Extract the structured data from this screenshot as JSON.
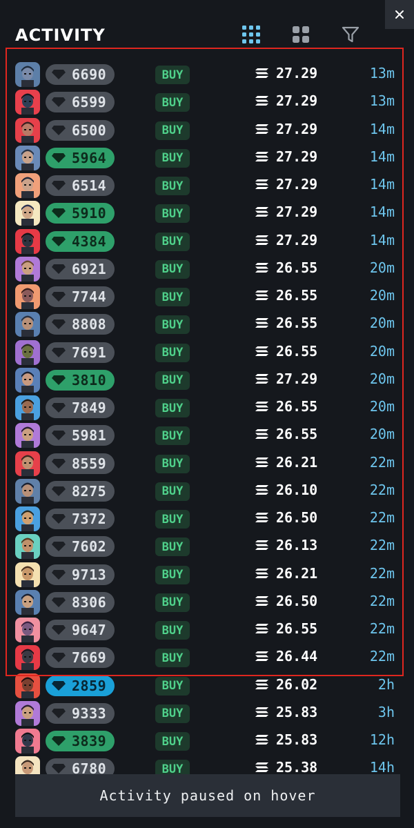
{
  "header": {
    "title": "ACTIVITY"
  },
  "icons": {
    "close": "close-icon",
    "grid_small": "grid-small-icon",
    "grid_large": "grid-large-icon",
    "filter": "filter-icon",
    "diamond": "diamond-icon",
    "currency": "solana-icon"
  },
  "colors": {
    "accent_blue": "#6ec6ee",
    "buy_green": "#4fd08a",
    "pill_gray": "#4b5058",
    "pill_green": "#2ea06a",
    "pill_blue": "#1aa0d8",
    "highlight_red": "#e0261f"
  },
  "activity": [
    {
      "rank": "6690",
      "rarity": "gray",
      "action": "BUY",
      "price": "27.29",
      "time": "13m",
      "avatar_bg": "#5d7fa8",
      "face": "#7a8aa8",
      "hair": "#1e2a3a"
    },
    {
      "rank": "6599",
      "rarity": "gray",
      "action": "BUY",
      "price": "27.29",
      "time": "13m",
      "avatar_bg": "#e8404c",
      "face": "#2e3f56",
      "hair": "#101820"
    },
    {
      "rank": "6500",
      "rarity": "gray",
      "action": "BUY",
      "price": "27.29",
      "time": "14m",
      "avatar_bg": "#e6404a",
      "face": "#b97a66",
      "hair": "#3a2020"
    },
    {
      "rank": "5964",
      "rarity": "green",
      "action": "BUY",
      "price": "27.29",
      "time": "14m",
      "avatar_bg": "#6a8ab8",
      "face": "#c8a28a",
      "hair": "#2a3444"
    },
    {
      "rank": "6514",
      "rarity": "gray",
      "action": "BUY",
      "price": "27.29",
      "time": "14m",
      "avatar_bg": "#f0a07a",
      "face": "#caa28a",
      "hair": "#20283a"
    },
    {
      "rank": "5910",
      "rarity": "green",
      "action": "BUY",
      "price": "27.29",
      "time": "14m",
      "avatar_bg": "#f4e8c0",
      "face": "#d0a888",
      "hair": "#2a3050"
    },
    {
      "rank": "4384",
      "rarity": "green",
      "action": "BUY",
      "price": "27.29",
      "time": "14m",
      "avatar_bg": "#e63a46",
      "face": "#2e3440",
      "hair": "#101418"
    },
    {
      "rank": "6921",
      "rarity": "gray",
      "action": "BUY",
      "price": "26.55",
      "time": "20m",
      "avatar_bg": "#b07ad8",
      "face": "#caa080",
      "hair": "#6a4a30"
    },
    {
      "rank": "7744",
      "rarity": "gray",
      "action": "BUY",
      "price": "26.55",
      "time": "20m",
      "avatar_bg": "#f09a70",
      "face": "#8a5a5a",
      "hair": "#3a2020"
    },
    {
      "rank": "8808",
      "rarity": "gray",
      "action": "BUY",
      "price": "26.55",
      "time": "20m",
      "avatar_bg": "#5a80b0",
      "face": "#b89078",
      "hair": "#2a3040"
    },
    {
      "rank": "7691",
      "rarity": "gray",
      "action": "BUY",
      "price": "26.55",
      "time": "20m",
      "avatar_bg": "#a070d0",
      "face": "#6a7040",
      "hair": "#2a2a20"
    },
    {
      "rank": "3810",
      "rarity": "green",
      "action": "BUY",
      "price": "27.29",
      "time": "20m",
      "avatar_bg": "#5a80b8",
      "face": "#c89a80",
      "hair": "#1a2030"
    },
    {
      "rank": "7849",
      "rarity": "gray",
      "action": "BUY",
      "price": "26.55",
      "time": "20m",
      "avatar_bg": "#4aa0e0",
      "face": "#9a6a50",
      "hair": "#2a1a10"
    },
    {
      "rank": "5981",
      "rarity": "gray",
      "action": "BUY",
      "price": "26.55",
      "time": "20m",
      "avatar_bg": "#b07ad8",
      "face": "#caa080",
      "hair": "#2a2030"
    },
    {
      "rank": "8559",
      "rarity": "gray",
      "action": "BUY",
      "price": "26.21",
      "time": "22m",
      "avatar_bg": "#e6404a",
      "face": "#c09070",
      "hair": "#3a2a20"
    },
    {
      "rank": "8275",
      "rarity": "gray",
      "action": "BUY",
      "price": "26.10",
      "time": "22m",
      "avatar_bg": "#6080a8",
      "face": "#b89078",
      "hair": "#1a2030"
    },
    {
      "rank": "7372",
      "rarity": "gray",
      "action": "BUY",
      "price": "26.50",
      "time": "22m",
      "avatar_bg": "#4aa0e0",
      "face": "#d0a070",
      "hair": "#2a2a20"
    },
    {
      "rank": "7602",
      "rarity": "gray",
      "action": "BUY",
      "price": "26.13",
      "time": "22m",
      "avatar_bg": "#6ad0c0",
      "face": "#c0906a",
      "hair": "#5a3a20"
    },
    {
      "rank": "9713",
      "rarity": "gray",
      "action": "BUY",
      "price": "26.21",
      "time": "22m",
      "avatar_bg": "#f4e0b0",
      "face": "#c8986a",
      "hair": "#4a3020"
    },
    {
      "rank": "8306",
      "rarity": "gray",
      "action": "BUY",
      "price": "26.50",
      "time": "22m",
      "avatar_bg": "#5a80b0",
      "face": "#c8a080",
      "hair": "#1a2030"
    },
    {
      "rank": "9647",
      "rarity": "gray",
      "action": "BUY",
      "price": "26.55",
      "time": "22m",
      "avatar_bg": "#f090a0",
      "face": "#7a5a80",
      "hair": "#3a2040"
    },
    {
      "rank": "7669",
      "rarity": "gray",
      "action": "BUY",
      "price": "26.44",
      "time": "22m",
      "avatar_bg": "#e63a46",
      "face": "#3a3a44",
      "hair": "#181820"
    },
    {
      "rank": "2859",
      "rarity": "blue",
      "action": "BUY",
      "price": "26.02",
      "time": "2h",
      "avatar_bg": "#e65040",
      "face": "#7a4030",
      "hair": "#201010"
    },
    {
      "rank": "9333",
      "rarity": "gray",
      "action": "BUY",
      "price": "25.83",
      "time": "3h",
      "avatar_bg": "#b07ad8",
      "face": "#caa080",
      "hair": "#2a2030"
    },
    {
      "rank": "3839",
      "rarity": "green",
      "action": "BUY",
      "price": "25.83",
      "time": "12h",
      "avatar_bg": "#f07a90",
      "face": "#30384a",
      "hair": "#101418"
    },
    {
      "rank": "6780",
      "rarity": "gray",
      "action": "BUY",
      "price": "25.38",
      "time": "14h",
      "avatar_bg": "#f4e4c0",
      "face": "#c89a78",
      "hair": "#3a2a20"
    }
  ],
  "toast": {
    "message": "Activity paused on hover"
  }
}
